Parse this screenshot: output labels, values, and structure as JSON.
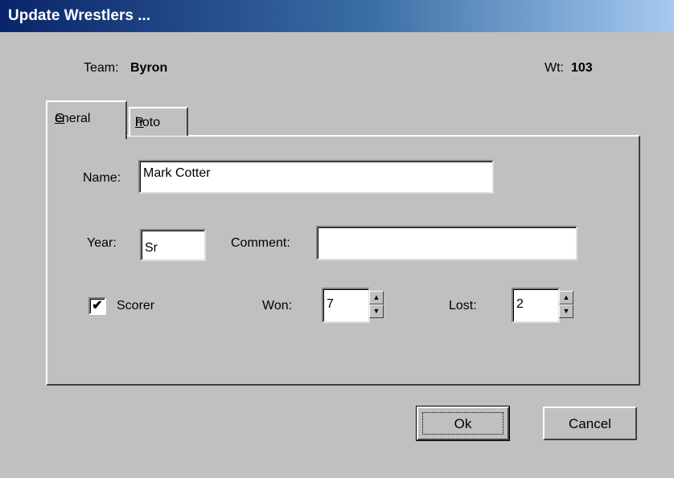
{
  "window": {
    "title": "Update Wrestlers ..."
  },
  "header": {
    "team_label": "Team:",
    "team_value": "Byron",
    "wt_label": "Wt:",
    "wt_value": "103"
  },
  "tabs": {
    "general": {
      "mnemonic": "G",
      "rest": "eneral"
    },
    "photo": {
      "mnemonic": "P",
      "rest": "hoto"
    }
  },
  "form": {
    "name_label": "Name:",
    "name_value": "Mark Cotter",
    "year_label": "Year:",
    "year_value": "Sr",
    "comment_label": "Comment:",
    "comment_value": "",
    "scorer_label": "Scorer",
    "scorer_checked": true,
    "won_label": "Won:",
    "won_value": "7",
    "lost_label": "Lost:",
    "lost_value": "2"
  },
  "buttons": {
    "ok_label": "Ok",
    "cancel_label": "Cancel"
  }
}
